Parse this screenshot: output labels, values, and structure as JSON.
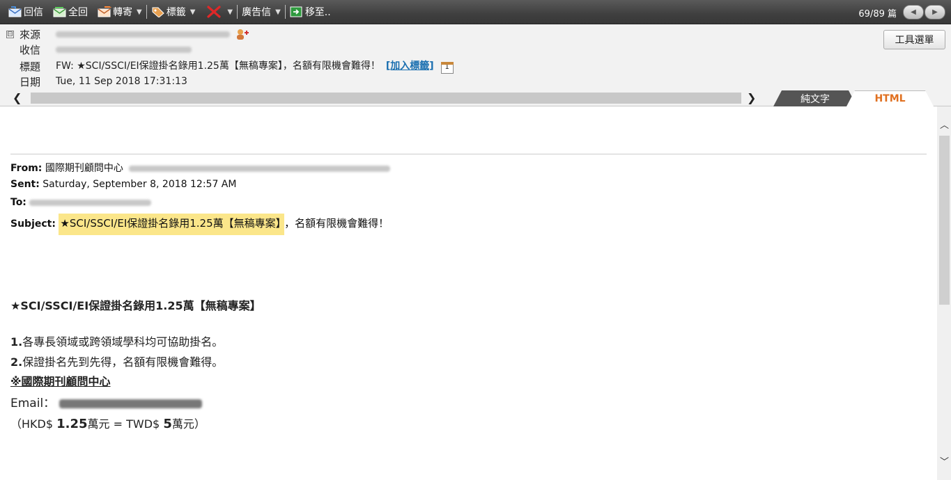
{
  "toolbar": {
    "reply_label": "回信",
    "reply_all_label": "全回",
    "forward_label": "轉寄",
    "tag_label": "標籤",
    "junk_label": "廣告信",
    "move_label": "移至..",
    "counter": "69/89 篇"
  },
  "header": {
    "from_label": "來源",
    "to_label": "收信",
    "subject_label": "標題",
    "date_label": "日期",
    "subject_value": "FW: ★SCI/SSCI/EI保證掛名錄用1.25萬【無稿專案】，名額有限機會難得！",
    "add_tag_link": "[加入標籤]",
    "date_value": "Tue, 11 Sep 2018 17:31:13",
    "tool_menu_label": "工具選單",
    "collapse_symbol": "⊟"
  },
  "tabs": {
    "plain": "純文字",
    "html": "HTML"
  },
  "message": {
    "from_label": "From:",
    "from_name": "國際期刊顧問中心",
    "sent_label": "Sent:",
    "sent_value": "Saturday, September 8, 2018 12:57 AM",
    "to_label": "To:",
    "subject_label": "Subject:",
    "subject_highlight": "★SCI/SSCI/EI保證掛名錄用1.25萬【無稿專案】",
    "subject_rest": "，名額有限機會難得！",
    "headline": "★SCI/SSCI/EI保證掛名錄用1.25萬【無稿專案】",
    "item1_num": "1.",
    "item1_text": "各專長領域或跨領域學科均可協助掛名。",
    "item2_num": "2.",
    "item2_text": "保證掛名先到先得，名額有限機會難得。",
    "org_line": "※國際期刊顧問中心",
    "email_label": "Email：",
    "price_open": "（HKD$ ",
    "price_hkd": "1.25",
    "price_mid": "萬元 = TWD$ ",
    "price_twd": "5",
    "price_close": "萬元）"
  },
  "colors": {
    "toolbar_bg": "#3f3f3f",
    "header_bg": "#f2f2f2",
    "link": "#1a6fb0",
    "highlight": "#fbe68a",
    "html_tab_text": "#e07020"
  }
}
